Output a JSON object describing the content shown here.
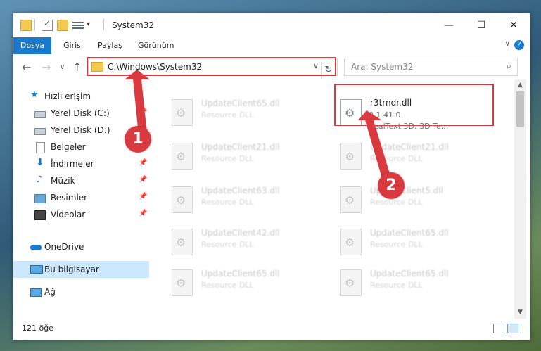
{
  "window": {
    "title": "System32",
    "controls": {
      "minimize": "—",
      "maximize": "☐",
      "close": "✕"
    }
  },
  "ribbon": {
    "tabs": [
      "Dosya",
      "Giriş",
      "Paylaş",
      "Görünüm"
    ],
    "help_glyph": "?"
  },
  "address": {
    "path": "C:\\Windows\\System32",
    "search_placeholder": "Ara: System32"
  },
  "nav": {
    "items": [
      {
        "label": "Hızlı erişim",
        "icon": "star-icon"
      },
      {
        "label": "Yerel Disk (C:)",
        "icon": "disk-icon",
        "pinned": true
      },
      {
        "label": "Yerel Disk (D:)",
        "icon": "disk-icon",
        "pinned": true
      },
      {
        "label": "Belgeler",
        "icon": "document-icon",
        "pinned": true
      },
      {
        "label": "İndirmeler",
        "icon": "download-icon",
        "pinned": true
      },
      {
        "label": "Müzik",
        "icon": "music-icon",
        "pinned": true
      },
      {
        "label": "Resimler",
        "icon": "pictures-icon",
        "pinned": true
      },
      {
        "label": "Videolar",
        "icon": "videos-icon",
        "pinned": true
      },
      {
        "label": "OneDrive",
        "icon": "cloud-icon"
      },
      {
        "label": "Bu bilgisayar",
        "icon": "computer-icon",
        "selected": true
      },
      {
        "label": "Ağ",
        "icon": "network-icon"
      }
    ]
  },
  "files": {
    "left": [
      {
        "name": "UpdateClient65.dll",
        "desc": "Resource DLL"
      },
      {
        "name": "UpdateClient21.dll",
        "desc": "Resource DLL"
      },
      {
        "name": "UpdateClient63.dll",
        "desc": "Resource DLL"
      },
      {
        "name": "UpdateClient42.dll",
        "desc": "Resource DLL"
      },
      {
        "name": "UpdateClient65.dll",
        "desc": "Resource DLL"
      }
    ],
    "right": [
      {
        "name": "r3trndr.dll",
        "version": "0.1.41.0",
        "desc": "RealText 3D:   3D Te..."
      },
      {
        "name": "UpdateClient21.dll",
        "desc": "Resource DLL"
      },
      {
        "name": "UpdateClient5.dll",
        "desc": "Resource DLL"
      },
      {
        "name": "UpdateClient65.dll",
        "desc": "Resource DLL"
      },
      {
        "name": "UpdateClient65.dll",
        "desc": "Resource DLL"
      }
    ]
  },
  "status": {
    "item_count": "121 öğe"
  },
  "annotations": {
    "badge1": "1",
    "badge2": "2",
    "color": "#d93a3f"
  }
}
